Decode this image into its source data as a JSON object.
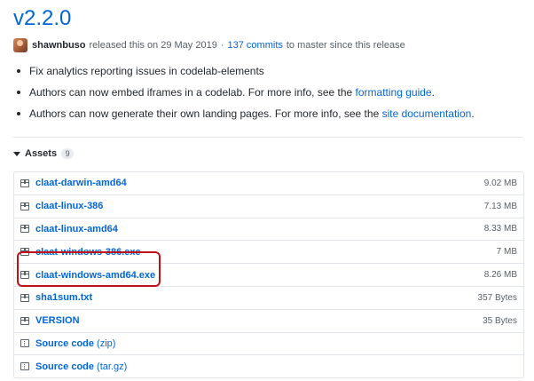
{
  "release": {
    "title": "v2.2.0",
    "author": "shawnbuso",
    "released_text": "released this on 29 May 2019",
    "separator": "·",
    "commits": "137 commits",
    "since_text": "to master since this release"
  },
  "notes": [
    {
      "text": "Fix analytics reporting issues in codelab-elements",
      "link": ""
    },
    {
      "text": "Authors can now embed iframes in a codelab. For more info, see the ",
      "link": "formatting guide",
      "suffix": "."
    },
    {
      "text": "Authors can now generate their own landing pages. For more info, see the ",
      "link": "site documentation",
      "suffix": "."
    }
  ],
  "assets": {
    "label": "Assets",
    "count": "9",
    "items": [
      {
        "name": "claat-darwin-amd64",
        "size": "9.02 MB"
      },
      {
        "name": "claat-linux-386",
        "size": "7.13 MB"
      },
      {
        "name": "claat-linux-amd64",
        "size": "8.33 MB"
      },
      {
        "name": "claat-windows-386.exe",
        "size": "7 MB"
      },
      {
        "name": "claat-windows-amd64.exe",
        "size": "8.26 MB"
      },
      {
        "name": "sha1sum.txt",
        "size": "357 Bytes"
      },
      {
        "name": "VERSION",
        "size": "35 Bytes"
      }
    ],
    "source": [
      {
        "label": "Source code",
        "ext": "(zip)"
      },
      {
        "label": "Source code",
        "ext": "(tar.gz)"
      }
    ]
  },
  "highlight_color": "#c0101e",
  "link_color": "#0366d6"
}
